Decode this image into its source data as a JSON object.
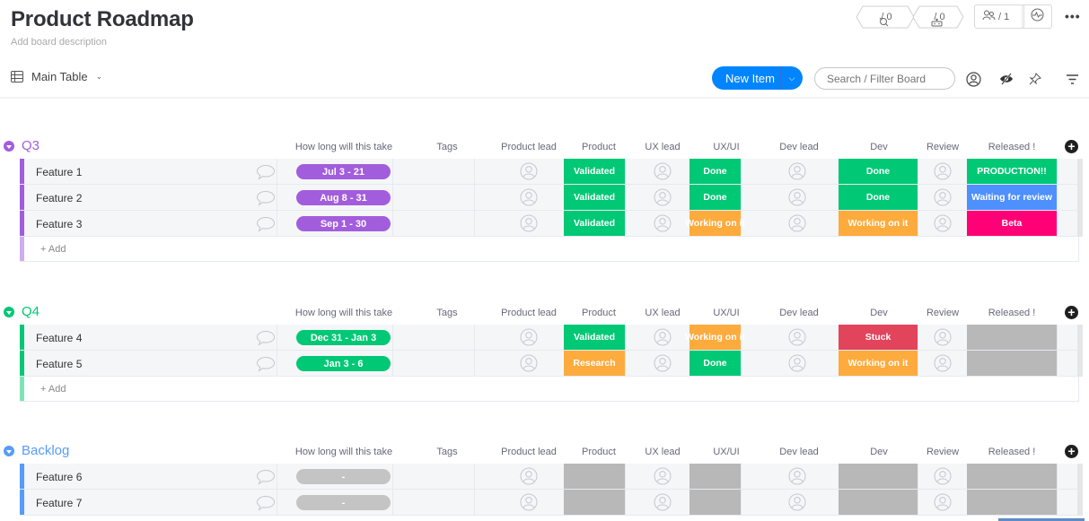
{
  "header": {
    "title": "Product Roadmap",
    "description": "Add board description",
    "view_tab": "Main Table",
    "integrations_count": "/ 0",
    "automations_count": "/ 0",
    "members_count": "/ 1",
    "more_label": "•••"
  },
  "toolbar": {
    "new_item_label": "New Item",
    "search_placeholder": "Search / Filter Board"
  },
  "columns": [
    "How long will this take",
    "Tags",
    "Product lead",
    "Product",
    "UX lead",
    "UX/UI",
    "Dev lead",
    "Dev",
    "Review",
    "Released !"
  ],
  "colors": {
    "purple": "#a25ddc",
    "green": "#00c875",
    "blue": "#579bfc",
    "orange": "#fdab3d",
    "red": "#e2445c",
    "pink": "#ff0076",
    "gray": "#c4c4c4",
    "released_blue": "#4d90fe"
  },
  "groups": [
    {
      "title": "Q3",
      "color": "#a25ddc",
      "add_label": "+ Add",
      "items": [
        {
          "name": "Feature 1",
          "timeline": "Jul 3 - 21",
          "product": "Validated",
          "ux": "Done",
          "dev": "Done",
          "released": "PRODUCTION!!"
        },
        {
          "name": "Feature 2",
          "timeline": "Aug 8 - 31",
          "product": "Validated",
          "ux": "Done",
          "dev": "Done",
          "released": "Waiting for review"
        },
        {
          "name": "Feature 3",
          "timeline": "Sep 1 - 30",
          "product": "Validated",
          "ux": "Working on it",
          "dev": "Working on it",
          "released": "Beta"
        }
      ]
    },
    {
      "title": "Q4",
      "color": "#00c875",
      "add_label": "+ Add",
      "items": [
        {
          "name": "Feature 4",
          "timeline": "Dec 31 - Jan 3",
          "product": "Validated",
          "ux": "Working on it",
          "dev": "Stuck",
          "released": ""
        },
        {
          "name": "Feature 5",
          "timeline": "Jan 3 - 6",
          "product": "Research",
          "ux": "Done",
          "dev": "Working on it",
          "released": ""
        }
      ]
    },
    {
      "title": "Backlog",
      "color": "#579bfc",
      "items": [
        {
          "name": "Feature 6",
          "timeline": "-",
          "product": "",
          "ux": "",
          "dev": "",
          "released": ""
        },
        {
          "name": "Feature 7",
          "timeline": "-",
          "product": "",
          "ux": "",
          "dev": "",
          "released": ""
        }
      ]
    }
  ],
  "status_colors": {
    "Validated": "#00c875",
    "Done": "#00c875",
    "PRODUCTION!!": "#00c875",
    "Working on it": "#fdab3d",
    "Research": "#fdab3d",
    "Stuck": "#e2445c",
    "Waiting for review": "#4d90fe",
    "Beta": "#ff0076",
    "": "#b8b8b8"
  }
}
